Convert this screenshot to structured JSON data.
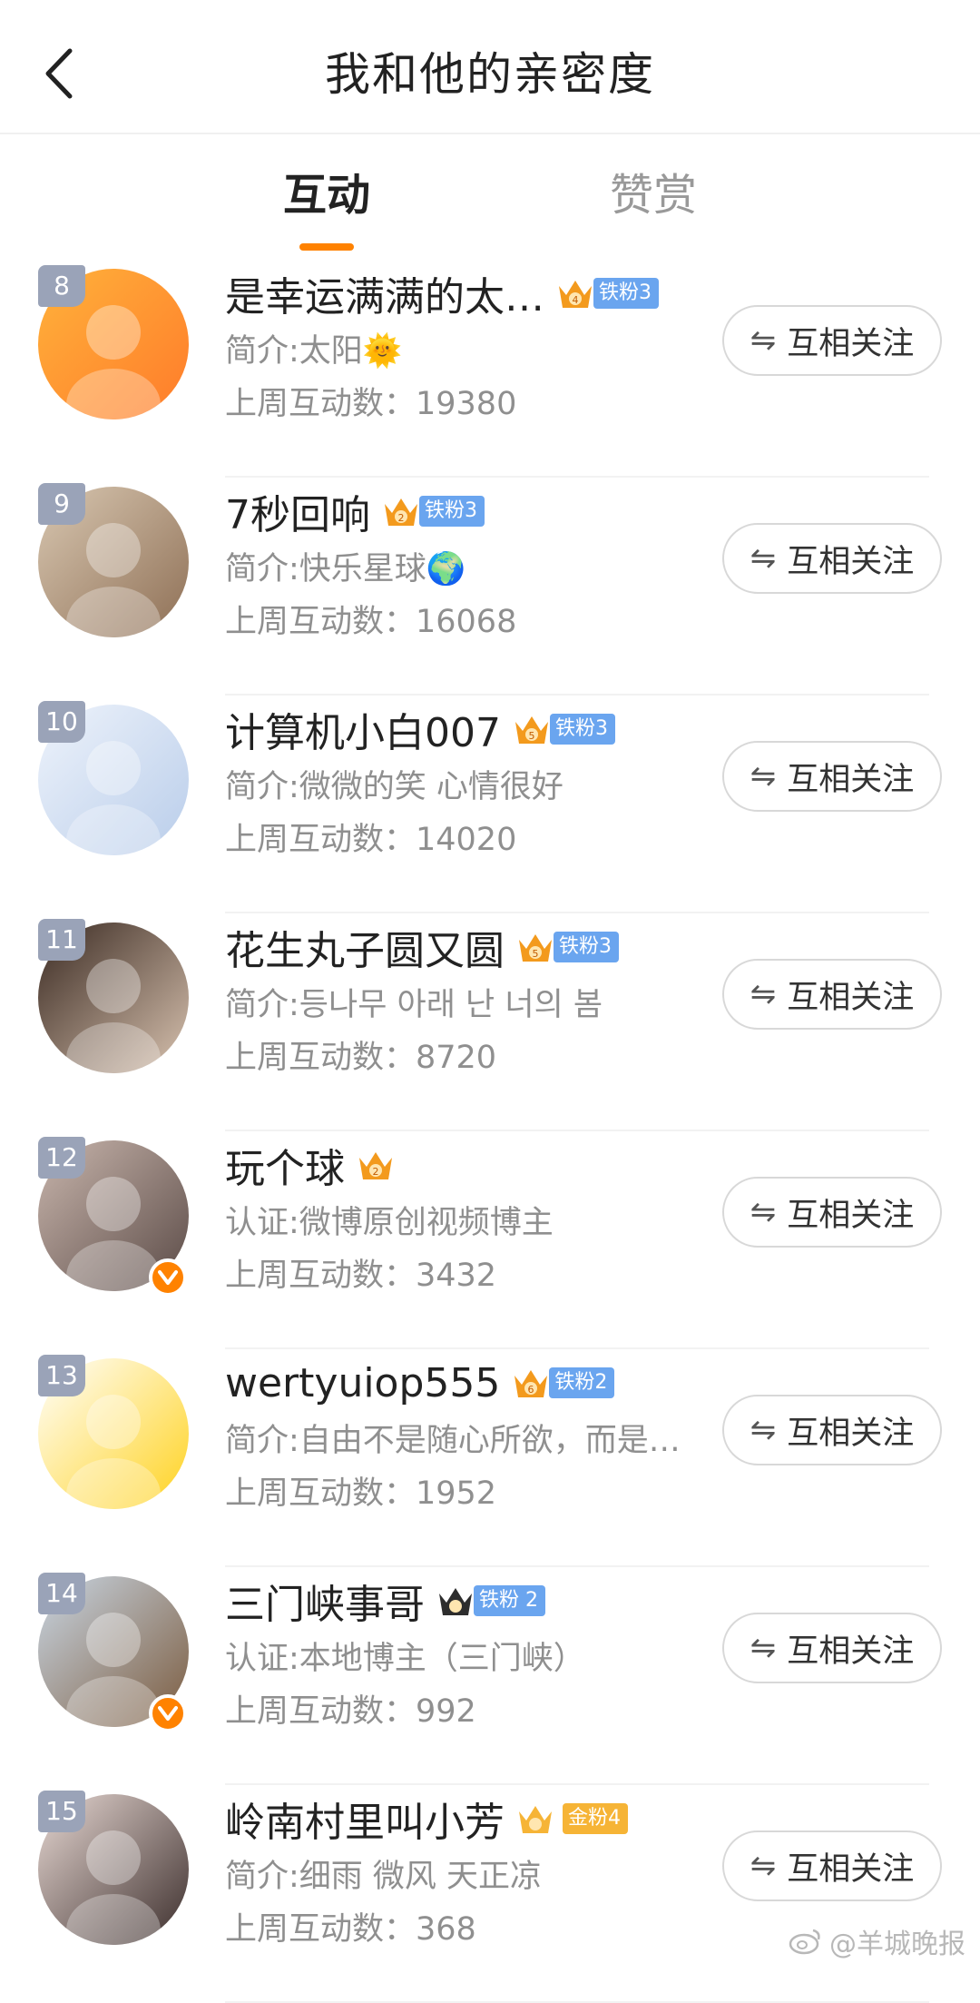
{
  "header": {
    "title": "我和他的亲密度"
  },
  "tabs": [
    {
      "label": "互动"
    },
    {
      "label": "赞赏"
    }
  ],
  "follow_label": "互相关注",
  "users": [
    {
      "rank": "8",
      "name": "是幸运满满的太…",
      "crown_level": "4",
      "crown_color": "#f39a1d",
      "fan_tag": "铁粉3",
      "fan_color": "#6aa5ef",
      "desc": "简介:太阳🌞",
      "count": "上周互动数：19380",
      "verified": false,
      "avatar_colors": [
        "#ffb23b",
        "#ff7b2a"
      ]
    },
    {
      "rank": "9",
      "name": "7秒回响",
      "crown_level": "2",
      "crown_color": "#f39a1d",
      "fan_tag": "铁粉3",
      "fan_color": "#6aa5ef",
      "desc": "简介:快乐星球🌍",
      "count": "上周互动数：16068",
      "verified": false,
      "avatar_colors": [
        "#d8c7b1",
        "#8e6f55"
      ]
    },
    {
      "rank": "10",
      "name": "计算机小白007",
      "crown_level": "5",
      "crown_color": "#f39a1d",
      "fan_tag": "铁粉3",
      "fan_color": "#6aa5ef",
      "desc": "简介:微微的笑 心情很好",
      "count": "上周互动数：14020",
      "verified": false,
      "avatar_colors": [
        "#eef3fb",
        "#b9cdea"
      ]
    },
    {
      "rank": "11",
      "name": "花生丸子圆又圆",
      "crown_level": "5",
      "crown_color": "#f39a1d",
      "fan_tag": "铁粉3",
      "fan_color": "#6aa5ef",
      "desc": "简介:등나무 아래 난 너의 봄",
      "count": "上周互动数：8720",
      "verified": false,
      "avatar_colors": [
        "#3a2a22",
        "#d9c3b0"
      ]
    },
    {
      "rank": "12",
      "name": "玩个球",
      "crown_level": "2",
      "crown_color": "#f39a1d",
      "fan_tag": "",
      "fan_color": "#6aa5ef",
      "desc": "认证:微博原创视频博主",
      "count": "上周互动数：3432",
      "verified": true,
      "avatar_colors": [
        "#c9b6ad",
        "#5a4a46"
      ]
    },
    {
      "rank": "13",
      "name": "wertyuiop555",
      "crown_level": "6",
      "crown_color": "#f39a1d",
      "fan_tag": "铁粉2",
      "fan_color": "#6aa5ef",
      "desc": "简介:自由不是随心所欲，而是…",
      "count": "上周互动数：1952",
      "verified": false,
      "avatar_colors": [
        "#ffffff",
        "#ffd21e"
      ]
    },
    {
      "rank": "14",
      "name": "三门峡事哥",
      "crown_level": "",
      "crown_color": "#2d2d2d",
      "fan_tag": "铁粉 2",
      "fan_color": "#6aa5ef",
      "desc": "认证:本地博主（三门峡）",
      "count": "上周互动数：992",
      "verified": true,
      "avatar_colors": [
        "#c9d6e3",
        "#7b5b3e"
      ]
    },
    {
      "rank": "15",
      "name": "岭南村里叫小芳",
      "crown_level": "",
      "crown_color": "#f6b436",
      "fan_tag": "金粉4",
      "fan_color": "#f6b436",
      "desc": "简介:细雨 微风 天正凉",
      "count": "上周互动数：368",
      "verified": false,
      "avatar_colors": [
        "#e8d9d4",
        "#3b2d2b"
      ]
    }
  ],
  "watermark": "@羊城晚报"
}
